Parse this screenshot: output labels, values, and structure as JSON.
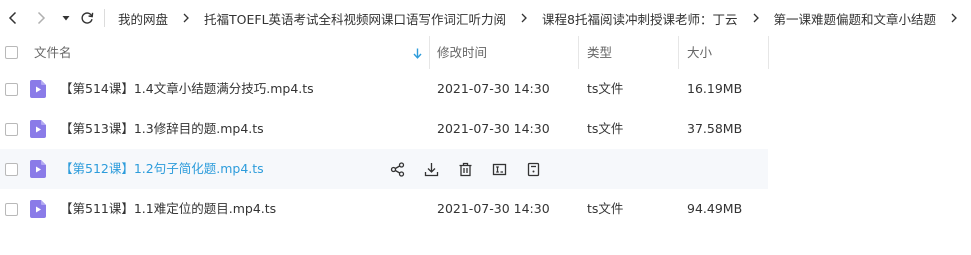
{
  "breadcrumb": [
    "我的网盘",
    "托福TOEFL英语考试全科视频网课口语写作词汇听力阅",
    "课程8托福阅读冲刺授课老师：丁云",
    "第一课难题偏题和文章小结题"
  ],
  "columns": {
    "name": "文件名",
    "modified": "修改时间",
    "type": "类型",
    "size": "大小"
  },
  "files": [
    {
      "name": "【第514课】1.4文章小结题满分技巧.mp4.ts",
      "modified": "2021-07-30 14:30",
      "type": "ts文件",
      "size": "16.19MB"
    },
    {
      "name": "【第513课】1.3修辞目的题.mp4.ts",
      "modified": "2021-07-30 14:30",
      "type": "ts文件",
      "size": "37.58MB"
    },
    {
      "name": "【第512课】1.2句子简化题.mp4.ts",
      "modified": "",
      "type": "",
      "size": ""
    },
    {
      "name": "【第511课】1.1难定位的题目.mp4.ts",
      "modified": "2021-07-30 14:30",
      "type": "ts文件",
      "size": "94.49MB"
    }
  ],
  "icons": {
    "back": "chevron-left-icon",
    "forward": "chevron-right-icon",
    "history": "caret-down-icon",
    "refresh": "refresh-icon",
    "sort": "arrow-down-icon",
    "file": "video-file-icon",
    "row_actions": [
      "share-icon",
      "download-icon",
      "delete-icon",
      "rename-icon",
      "more-icon"
    ]
  },
  "colors": {
    "accent": "#2d9cdb",
    "file_icon": "#8a7be8",
    "hover_row": "#f6f8fb"
  }
}
